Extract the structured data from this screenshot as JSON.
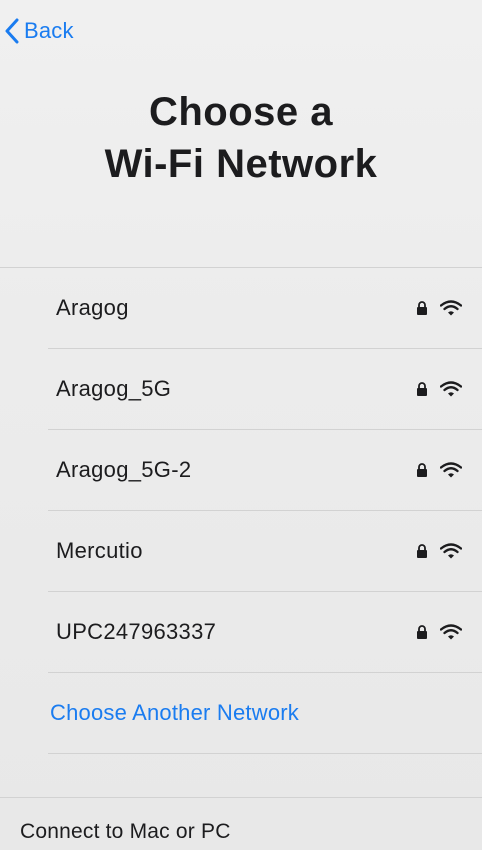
{
  "nav": {
    "back_label": "Back"
  },
  "header": {
    "title_line1": "Choose a",
    "title_line2": "Wi-Fi Network"
  },
  "networks": [
    {
      "name": "Aragog",
      "secured": true,
      "icons": [
        "lock-icon",
        "wifi-icon"
      ]
    },
    {
      "name": "Aragog_5G",
      "secured": true,
      "icons": [
        "lock-icon",
        "wifi-icon"
      ]
    },
    {
      "name": "Aragog_5G-2",
      "secured": true,
      "icons": [
        "lock-icon",
        "wifi-icon"
      ]
    },
    {
      "name": "Mercutio",
      "secured": true,
      "icons": [
        "lock-icon",
        "wifi-icon"
      ]
    },
    {
      "name": "UPC247963337",
      "secured": true,
      "icons": [
        "lock-icon",
        "wifi-icon"
      ]
    }
  ],
  "other_network": {
    "label": "Choose Another Network"
  },
  "connect": {
    "label": "Connect to Mac or PC"
  },
  "colors": {
    "accent": "#1a7cf0",
    "text": "#1c1c1e",
    "background": "#eeeeee",
    "separator": "#d2d2d2"
  }
}
